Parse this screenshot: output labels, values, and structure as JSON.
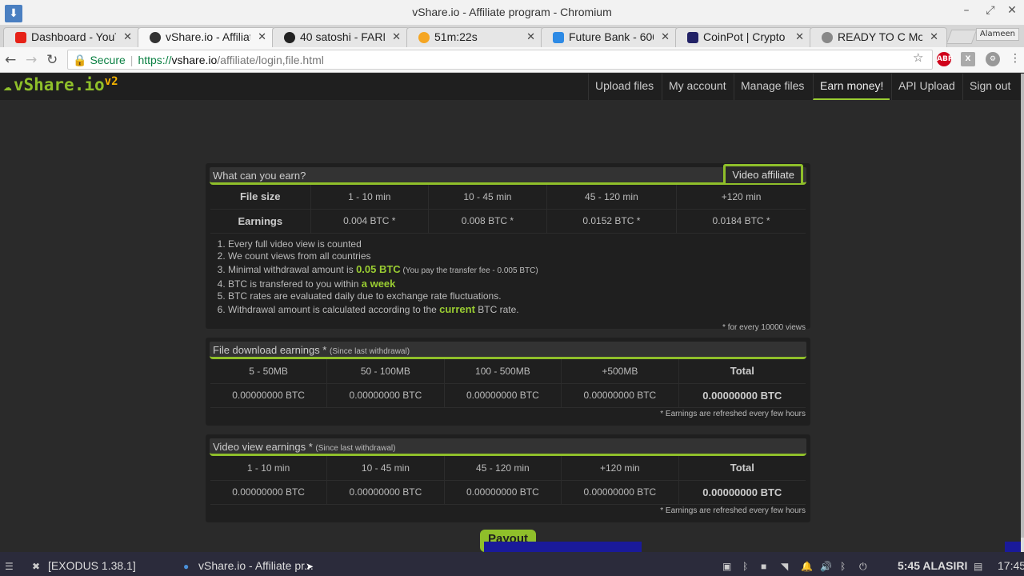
{
  "window": {
    "title": "vShare.io - Affiliate program - Chromium"
  },
  "tabs": [
    {
      "label": "Dashboard - YouT",
      "fav_color": "#e62117"
    },
    {
      "label": "vShare.io - Affiliat",
      "fav_color": "#333333",
      "active": true
    },
    {
      "label": "40 satoshi - FARM",
      "fav_color": "#222222"
    },
    {
      "label": "51m:22s",
      "fav_color": "#f5a623"
    },
    {
      "label": "Future Bank - 600",
      "fav_color": "#2d8ae5"
    },
    {
      "label": "CoinPot | Crypto",
      "fav_color": "#222266"
    },
    {
      "label": "READY TO C Mo",
      "fav_color": "#888888"
    }
  ],
  "user_badge": "Alameen",
  "address": {
    "secure": "Secure",
    "scheme": "https://",
    "host": "vshare.io",
    "path": "/affiliate/login,file.html"
  },
  "extensions": {
    "abp": "ABP",
    "x": "X"
  },
  "site": {
    "logo": "vShare.io",
    "logo_badge": "v2",
    "nav": [
      "Upload files",
      "My account",
      "Manage files",
      "Earn money!",
      "API Upload",
      "Sign out"
    ]
  },
  "earn": {
    "header": "What can you earn?",
    "pill": "Video affiliate",
    "row1_label": "File size",
    "row2_label": "Earnings",
    "sizes": [
      "1 - 10 min",
      "10 - 45 min",
      "45 - 120 min",
      "+120 min"
    ],
    "earnings": [
      "0.004 BTC *",
      "0.008 BTC *",
      "0.0152 BTC *",
      "0.0184 BTC *"
    ],
    "list": {
      "i1": "Every full video view is counted",
      "i2": "We count views from all countries",
      "i3a": "Minimal withdrawal amount is ",
      "i3b": "0.05 BTC",
      "i3c": " (You pay the transfer fee - 0.005 BTC)",
      "i4a": "BTC is transfered to you within ",
      "i4b": "a week",
      "i5": "BTC rates are evaluated daily due to exchange rate fluctuations.",
      "i6a": "Withdrawal amount is calculated according to the ",
      "i6b": "current",
      "i6c": " BTC rate."
    },
    "note": "* for every 10000 views"
  },
  "download": {
    "header": "File download earnings *",
    "sub": "(Since last withdrawal)",
    "cols": [
      "5 - 50MB",
      "50 - 100MB",
      "100 - 500MB",
      "+500MB",
      "Total"
    ],
    "vals": [
      "0.00000000 BTC",
      "0.00000000 BTC",
      "0.00000000 BTC",
      "0.00000000 BTC",
      "0.00000000 BTC"
    ],
    "note": "* Earnings are refreshed every few hours"
  },
  "video": {
    "header": "Video view earnings *",
    "sub": "(Since last withdrawal)",
    "cols": [
      "1 - 10 min",
      "10 - 45 min",
      "45 - 120 min",
      "+120 min",
      "Total"
    ],
    "vals": [
      "0.00000000 BTC",
      "0.00000000 BTC",
      "0.00000000 BTC",
      "0.00000000 BTC",
      "0.00000000 BTC"
    ],
    "note": "* Earnings are refreshed every few hours"
  },
  "payout": "Payout",
  "taskbar": {
    "app1": "[EXODUS 1.38.1]",
    "app2": "vShare.io - Affiliate pr...",
    "clock1": "5:45 ALASIRI",
    "clock2": "17:45"
  }
}
